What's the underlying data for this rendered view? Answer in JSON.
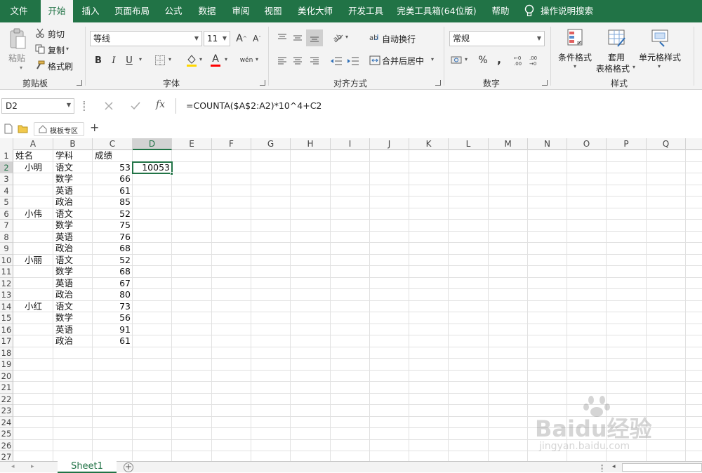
{
  "menu": {
    "tabs": [
      "文件",
      "开始",
      "插入",
      "页面布局",
      "公式",
      "数据",
      "审阅",
      "视图",
      "美化大师",
      "开发工具",
      "完美工具箱(64位版)",
      "帮助"
    ],
    "active": "开始",
    "search_label": "操作说明搜索"
  },
  "ribbon": {
    "clipboard": {
      "paste": "粘贴",
      "cut": "剪切",
      "copy": "复制",
      "format_painter": "格式刷",
      "label": "剪贴板"
    },
    "font": {
      "name": "等线",
      "size": "11",
      "bold": "B",
      "italic": "I",
      "underline": "U",
      "label": "字体",
      "grow": "A",
      "shrink": "A",
      "color_a": "A",
      "phonetic": "wén"
    },
    "alignment": {
      "wrap": "自动换行",
      "merge": "合并后居中",
      "label": "对齐方式"
    },
    "number": {
      "format": "常规",
      "percent": "%",
      "comma": ",",
      "label": "数字"
    },
    "styles": {
      "conditional": "条件格式",
      "table_line1": "套用",
      "table_line2": "表格格式",
      "cell_styles": "单元格样式",
      "label": "样式"
    }
  },
  "formula_bar": {
    "name_box": "D2",
    "formula": "=COUNTA($A$2:A2)*10^4+C2",
    "fx": "fx"
  },
  "qat": {
    "template_zone": "模板专区",
    "plus": "+"
  },
  "grid": {
    "columns": [
      "A",
      "B",
      "C",
      "D",
      "E",
      "F",
      "G",
      "H",
      "I",
      "J",
      "K",
      "L",
      "M",
      "N",
      "O",
      "P",
      "Q"
    ],
    "row_numbers": [
      "1",
      "2",
      "3",
      "4",
      "5",
      "6",
      "7",
      "8",
      "9",
      "10",
      "11",
      "12",
      "13",
      "14",
      "15",
      "16",
      "17",
      "18",
      "19",
      "20",
      "21",
      "22",
      "23",
      "24",
      "25",
      "26",
      "27"
    ],
    "selected_cell": "D2",
    "header": {
      "A": "姓名",
      "B": "学科",
      "C": "成绩"
    },
    "names": [
      "小明",
      "",
      "",
      "",
      "小伟",
      "",
      "",
      "",
      "小丽",
      "",
      "",
      "",
      "小红",
      "",
      "",
      ""
    ],
    "subjects": [
      "语文",
      "数学",
      "英语",
      "政治",
      "语文",
      "数学",
      "英语",
      "政治",
      "语文",
      "数学",
      "英语",
      "政治",
      "语文",
      "数学",
      "英语",
      "政治"
    ],
    "scores": [
      "53",
      "66",
      "61",
      "85",
      "52",
      "75",
      "76",
      "68",
      "52",
      "68",
      "67",
      "80",
      "73",
      "56",
      "91",
      "61"
    ],
    "d2_value": "10053"
  },
  "sheet_tabs": {
    "active": "Sheet1",
    "add": "+"
  },
  "watermark": {
    "brand": "Baidu经验",
    "url": "jingyan.baidu.com"
  }
}
